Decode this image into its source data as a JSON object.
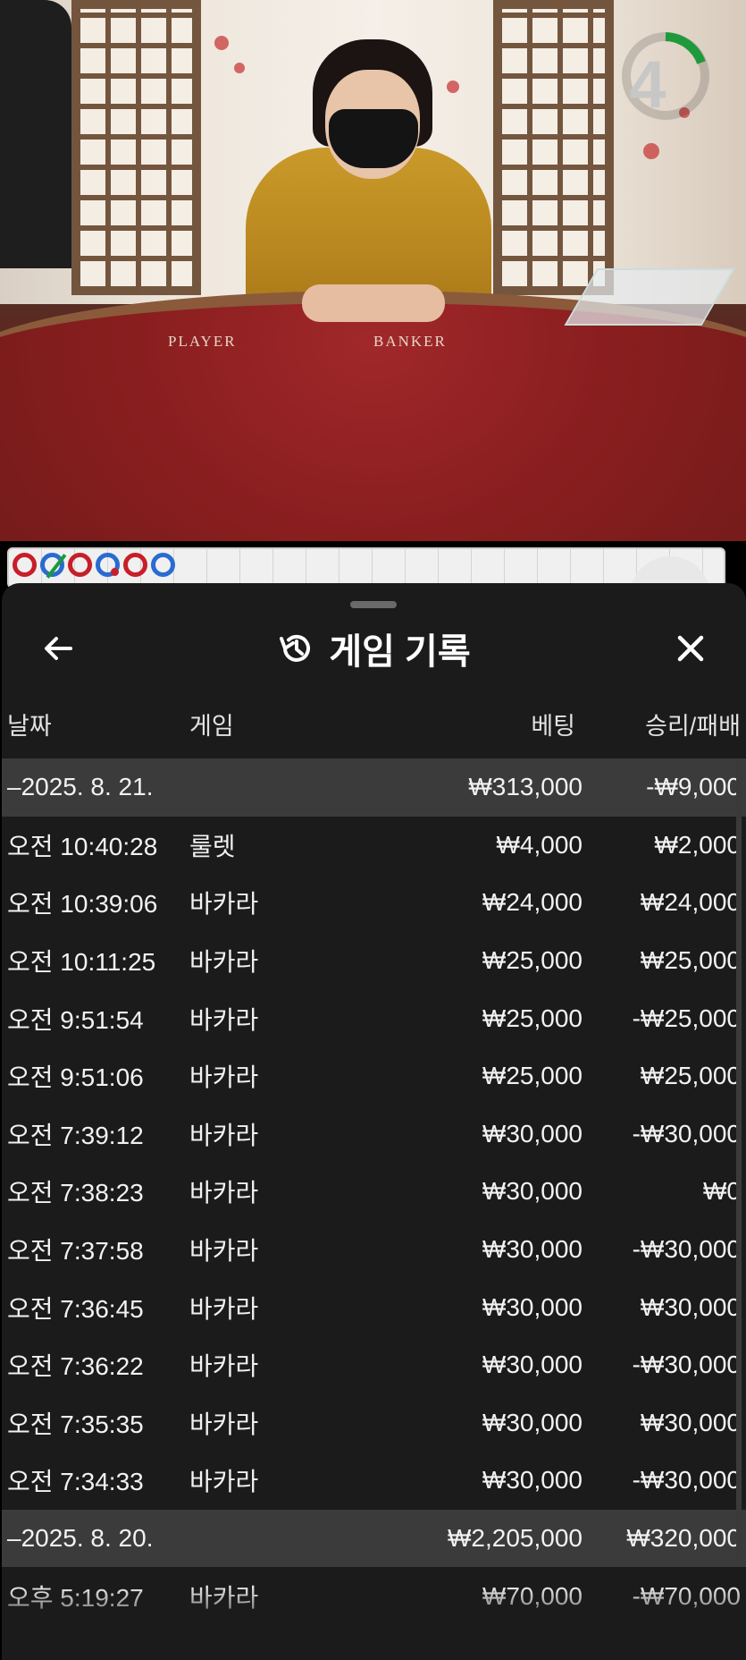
{
  "video": {
    "timer": "4",
    "felt_labels": [
      "PLAYER",
      "BANKER"
    ]
  },
  "roadmap": {
    "circles": [
      "red",
      "blue-slash",
      "red",
      "blue-dot",
      "red",
      "blue"
    ]
  },
  "sheet": {
    "title": "게임 기록",
    "back_icon": "arrow-left-icon",
    "history_icon": "history-icon",
    "close_icon": "close-icon",
    "columns": {
      "date": "날짜",
      "game": "게임",
      "bet": "베팅",
      "result": "승리/패배"
    },
    "rows": [
      {
        "type": "group",
        "date": "–2025. 8. 21.",
        "game": "",
        "bet": "₩313,000",
        "result": "-₩9,000"
      },
      {
        "type": "item",
        "date": "오전 10:40:28",
        "game": "룰렛",
        "bet": "₩4,000",
        "result": "₩2,000"
      },
      {
        "type": "item",
        "date": "오전 10:39:06",
        "game": "바카라",
        "bet": "₩24,000",
        "result": "₩24,000"
      },
      {
        "type": "item",
        "date": "오전 10:11:25",
        "game": "바카라",
        "bet": "₩25,000",
        "result": "₩25,000"
      },
      {
        "type": "item",
        "date": "오전 9:51:54",
        "game": "바카라",
        "bet": "₩25,000",
        "result": "-₩25,000"
      },
      {
        "type": "item",
        "date": "오전 9:51:06",
        "game": "바카라",
        "bet": "₩25,000",
        "result": "₩25,000"
      },
      {
        "type": "item",
        "date": "오전 7:39:12",
        "game": "바카라",
        "bet": "₩30,000",
        "result": "-₩30,000"
      },
      {
        "type": "item",
        "date": "오전 7:38:23",
        "game": "바카라",
        "bet": "₩30,000",
        "result": "₩0"
      },
      {
        "type": "item",
        "date": "오전 7:37:58",
        "game": "바카라",
        "bet": "₩30,000",
        "result": "-₩30,000"
      },
      {
        "type": "item",
        "date": "오전 7:36:45",
        "game": "바카라",
        "bet": "₩30,000",
        "result": "₩30,000"
      },
      {
        "type": "item",
        "date": "오전 7:36:22",
        "game": "바카라",
        "bet": "₩30,000",
        "result": "-₩30,000"
      },
      {
        "type": "item",
        "date": "오전 7:35:35",
        "game": "바카라",
        "bet": "₩30,000",
        "result": "₩30,000"
      },
      {
        "type": "item",
        "date": "오전 7:34:33",
        "game": "바카라",
        "bet": "₩30,000",
        "result": "-₩30,000"
      },
      {
        "type": "group",
        "date": "–2025. 8. 20.",
        "game": "",
        "bet": "₩2,205,000",
        "result": "₩320,000"
      },
      {
        "type": "item",
        "date": "오후 5:19:27",
        "game": "바카라",
        "bet": "₩70,000",
        "result": "-₩70,000"
      }
    ]
  }
}
